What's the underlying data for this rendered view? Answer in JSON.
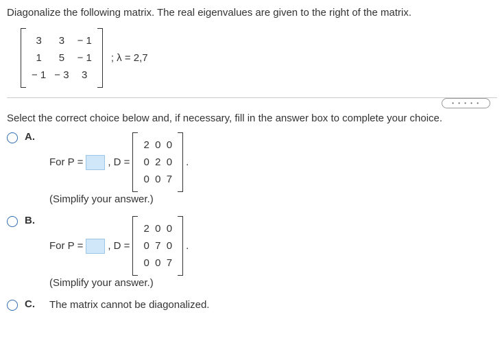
{
  "question": "Diagonalize the following matrix. The real eigenvalues are given to the right of the matrix.",
  "matrix": {
    "r1c1": "3",
    "r1c2": "3",
    "r1c3": "− 1",
    "r2c1": "1",
    "r2c2": "5",
    "r2c3": "− 1",
    "r3c1": "− 1",
    "r3c2": "− 3",
    "r3c3": "3"
  },
  "eigenvalues": "; λ = 2,7",
  "dots": "• • • • •",
  "instruction": "Select the correct choice below and, if necessary, fill in the answer box to complete your choice.",
  "choices": {
    "a": {
      "label": "A.",
      "prefix": "For P =",
      "dtext": ", D =",
      "d": {
        "r1": "2  0  0",
        "r2": "0  2  0",
        "r3": "0  0  7"
      },
      "simplify": "(Simplify your answer.)"
    },
    "b": {
      "label": "B.",
      "prefix": "For P =",
      "dtext": ", D =",
      "d": {
        "r1": "2  0  0",
        "r2": "0  7  0",
        "r3": "0  0  7"
      },
      "simplify": "(Simplify your answer.)"
    },
    "c": {
      "label": "C.",
      "text": "The matrix cannot be diagonalized."
    }
  },
  "chart_data": {
    "type": "table",
    "title": "3x3 matrix with eigenvalues",
    "matrix": [
      [
        3,
        3,
        -1
      ],
      [
        1,
        5,
        -1
      ],
      [
        -1,
        -3,
        3
      ]
    ],
    "eigenvalues": [
      2,
      7
    ],
    "option_A_D": [
      [
        2,
        0,
        0
      ],
      [
        0,
        2,
        0
      ],
      [
        0,
        0,
        7
      ]
    ],
    "option_B_D": [
      [
        2,
        0,
        0
      ],
      [
        0,
        7,
        0
      ],
      [
        0,
        0,
        7
      ]
    ]
  }
}
